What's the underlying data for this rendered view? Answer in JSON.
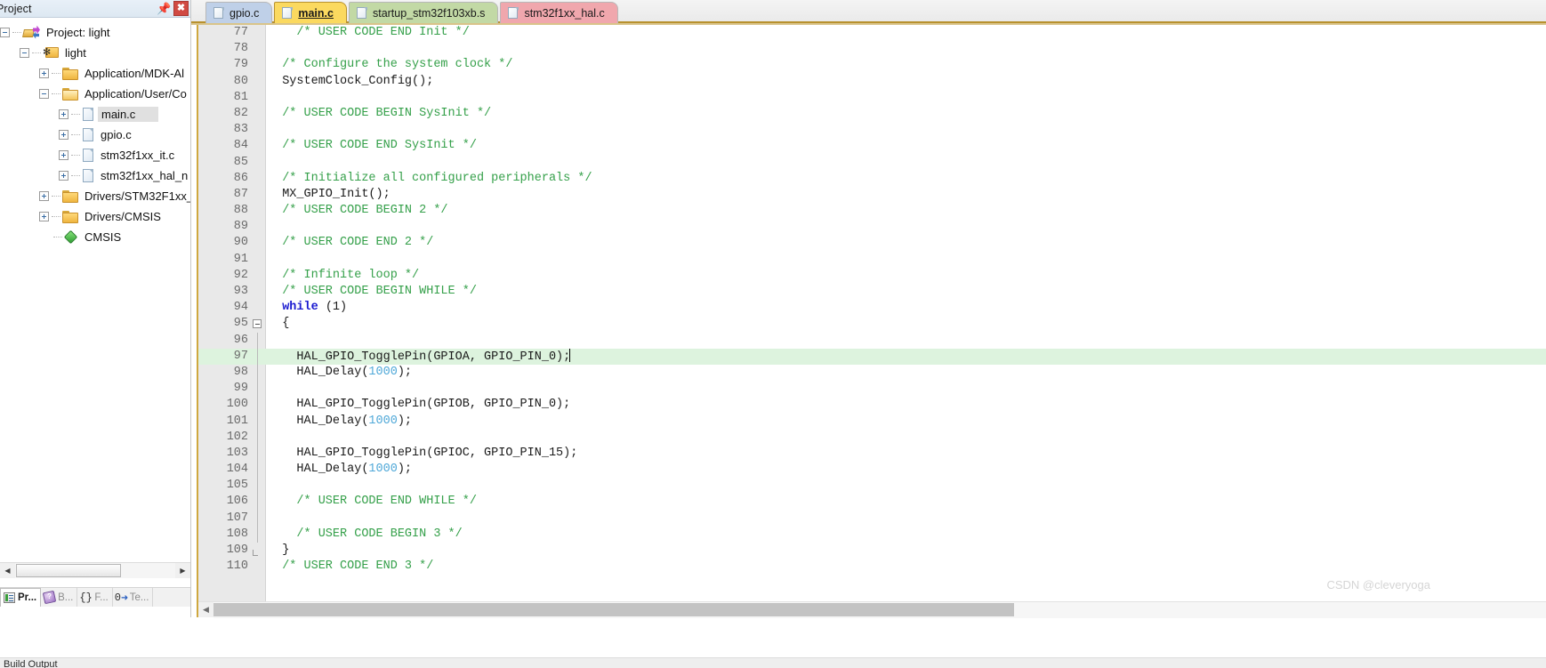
{
  "project_panel": {
    "title": "Project",
    "pin_icon": "pin-icon",
    "close_icon": "close-icon",
    "tree": [
      {
        "label": "Project: light",
        "depth": 0,
        "icon": "project-icon",
        "expander": "minus",
        "selected": false
      },
      {
        "label": "light",
        "depth": 1,
        "icon": "target-icon",
        "expander": "minus",
        "selected": false
      },
      {
        "label": "Application/MDK-Al",
        "depth": 2,
        "icon": "folder-icon",
        "expander": "plus",
        "selected": false
      },
      {
        "label": "Application/User/Co",
        "depth": 2,
        "icon": "folder-open-icon",
        "expander": "minus",
        "selected": false
      },
      {
        "label": "main.c",
        "depth": 3,
        "icon": "file-icon",
        "expander": "plus",
        "selected": true
      },
      {
        "label": "gpio.c",
        "depth": 3,
        "icon": "file-icon",
        "expander": "plus",
        "selected": false
      },
      {
        "label": "stm32f1xx_it.c",
        "depth": 3,
        "icon": "file-icon",
        "expander": "plus",
        "selected": false
      },
      {
        "label": "stm32f1xx_hal_n",
        "depth": 3,
        "icon": "file-icon",
        "expander": "plus",
        "selected": false
      },
      {
        "label": "Drivers/STM32F1xx_",
        "depth": 2,
        "icon": "folder-icon",
        "expander": "plus",
        "selected": false
      },
      {
        "label": "Drivers/CMSIS",
        "depth": 2,
        "icon": "folder-icon",
        "expander": "plus",
        "selected": false
      },
      {
        "label": "CMSIS",
        "depth": 2,
        "icon": "diamond-icon",
        "expander": "none",
        "selected": false
      }
    ],
    "bottom_tabs": [
      {
        "label": "Pr...",
        "icon": "project-panel-icon",
        "active": true
      },
      {
        "label": "B...",
        "icon": "books-icon",
        "active": false
      },
      {
        "label": "F...",
        "icon": "functions-icon",
        "active": false
      },
      {
        "label": "Te...",
        "icon": "templates-icon",
        "active": false
      }
    ],
    "scroll_left_icon": "left-arrow-icon",
    "scroll_right_icon": "right-arrow-icon"
  },
  "editor": {
    "tabs": [
      {
        "label": "gpio.c",
        "color": "#bfd0e8",
        "active": false
      },
      {
        "label": "main.c",
        "color": "#fbd95f",
        "active": true
      },
      {
        "label": "startup_stm32f103xb.s",
        "color": "#c2d9a5",
        "active": false
      },
      {
        "label": "stm32f1xx_hal.c",
        "color": "#f0a7ad",
        "active": false
      }
    ],
    "active_tab": "main.c",
    "current_line": 97,
    "scroll_left_icon": "left-arrow-icon",
    "scroll_right_icon": "right-arrow-icon",
    "lines": [
      {
        "n": 77,
        "fold": "none",
        "tokens": [
          {
            "t": "    /* USER CODE END Init */",
            "c": "cmt"
          }
        ]
      },
      {
        "n": 78,
        "fold": "none",
        "tokens": []
      },
      {
        "n": 79,
        "fold": "none",
        "tokens": [
          {
            "t": "  /* Configure the system clock */",
            "c": "cmt"
          }
        ]
      },
      {
        "n": 80,
        "fold": "none",
        "tokens": [
          {
            "t": "  SystemClock_Config();",
            "c": "plain"
          }
        ]
      },
      {
        "n": 81,
        "fold": "none",
        "tokens": []
      },
      {
        "n": 82,
        "fold": "none",
        "tokens": [
          {
            "t": "  /* USER CODE BEGIN SysInit */",
            "c": "cmt"
          }
        ]
      },
      {
        "n": 83,
        "fold": "none",
        "tokens": []
      },
      {
        "n": 84,
        "fold": "none",
        "tokens": [
          {
            "t": "  /* USER CODE END SysInit */",
            "c": "cmt"
          }
        ]
      },
      {
        "n": 85,
        "fold": "none",
        "tokens": []
      },
      {
        "n": 86,
        "fold": "none",
        "tokens": [
          {
            "t": "  /* Initialize all configured peripherals */",
            "c": "cmt"
          }
        ]
      },
      {
        "n": 87,
        "fold": "none",
        "tokens": [
          {
            "t": "  MX_GPIO_Init();",
            "c": "plain"
          }
        ]
      },
      {
        "n": 88,
        "fold": "none",
        "tokens": [
          {
            "t": "  /* USER CODE BEGIN 2 */",
            "c": "cmt"
          }
        ]
      },
      {
        "n": 89,
        "fold": "none",
        "tokens": []
      },
      {
        "n": 90,
        "fold": "none",
        "tokens": [
          {
            "t": "  /* USER CODE END 2 */",
            "c": "cmt"
          }
        ]
      },
      {
        "n": 91,
        "fold": "none",
        "tokens": []
      },
      {
        "n": 92,
        "fold": "none",
        "tokens": [
          {
            "t": "  /* Infinite loop */",
            "c": "cmt"
          }
        ]
      },
      {
        "n": 93,
        "fold": "none",
        "tokens": [
          {
            "t": "  /* USER CODE BEGIN WHILE */",
            "c": "cmt"
          }
        ]
      },
      {
        "n": 94,
        "fold": "none",
        "tokens": [
          {
            "t": "  ",
            "c": "plain"
          },
          {
            "t": "while",
            "c": "kw"
          },
          {
            "t": " (1)",
            "c": "plain"
          }
        ]
      },
      {
        "n": 95,
        "fold": "box",
        "tokens": [
          {
            "t": "  {",
            "c": "plain"
          }
        ]
      },
      {
        "n": 96,
        "fold": "bar",
        "tokens": []
      },
      {
        "n": 97,
        "fold": "bar",
        "highlight": true,
        "caret": true,
        "tokens": [
          {
            "t": "    HAL_GPIO_TogglePin(GPIOA, GPIO_PIN_0);",
            "c": "plain"
          }
        ]
      },
      {
        "n": 98,
        "fold": "bar",
        "tokens": [
          {
            "t": "    HAL_Delay(",
            "c": "plain"
          },
          {
            "t": "1000",
            "c": "num"
          },
          {
            "t": ");",
            "c": "plain"
          }
        ]
      },
      {
        "n": 99,
        "fold": "bar",
        "tokens": []
      },
      {
        "n": 100,
        "fold": "bar",
        "tokens": [
          {
            "t": "    HAL_GPIO_TogglePin(GPIOB, GPIO_PIN_0);",
            "c": "plain"
          }
        ]
      },
      {
        "n": 101,
        "fold": "bar",
        "tokens": [
          {
            "t": "    HAL_Delay(",
            "c": "plain"
          },
          {
            "t": "1000",
            "c": "num"
          },
          {
            "t": ");",
            "c": "plain"
          }
        ]
      },
      {
        "n": 102,
        "fold": "bar",
        "tokens": []
      },
      {
        "n": 103,
        "fold": "bar",
        "tokens": [
          {
            "t": "    HAL_GPIO_TogglePin(GPIOC, GPIO_PIN_15);",
            "c": "plain"
          }
        ]
      },
      {
        "n": 104,
        "fold": "bar",
        "tokens": [
          {
            "t": "    HAL_Delay(",
            "c": "plain"
          },
          {
            "t": "1000",
            "c": "num"
          },
          {
            "t": ");",
            "c": "plain"
          }
        ]
      },
      {
        "n": 105,
        "fold": "bar",
        "tokens": []
      },
      {
        "n": 106,
        "fold": "bar",
        "tokens": [
          {
            "t": "    /* USER CODE END WHILE */",
            "c": "cmt"
          }
        ]
      },
      {
        "n": 107,
        "fold": "bar",
        "tokens": []
      },
      {
        "n": 108,
        "fold": "bar",
        "tokens": [
          {
            "t": "    /* USER CODE BEGIN 3 */",
            "c": "cmt"
          }
        ]
      },
      {
        "n": 109,
        "fold": "end",
        "tokens": [
          {
            "t": "  }",
            "c": "plain"
          }
        ]
      },
      {
        "n": 110,
        "fold": "none",
        "tokens": [
          {
            "t": "  /* USER CODE END 3 */",
            "c": "cmt"
          }
        ]
      }
    ]
  },
  "watermark": "CSDN @cleveryoga",
  "bottom": {
    "output_label": "Build Output"
  },
  "colors": {
    "comment": "#35a04a",
    "keyword": "#1a1ad0",
    "number": "#4fa8d8",
    "current_line_highlight": "#ddf3de",
    "tab_accent": "#b8912f",
    "close_button": "#d04a43"
  }
}
